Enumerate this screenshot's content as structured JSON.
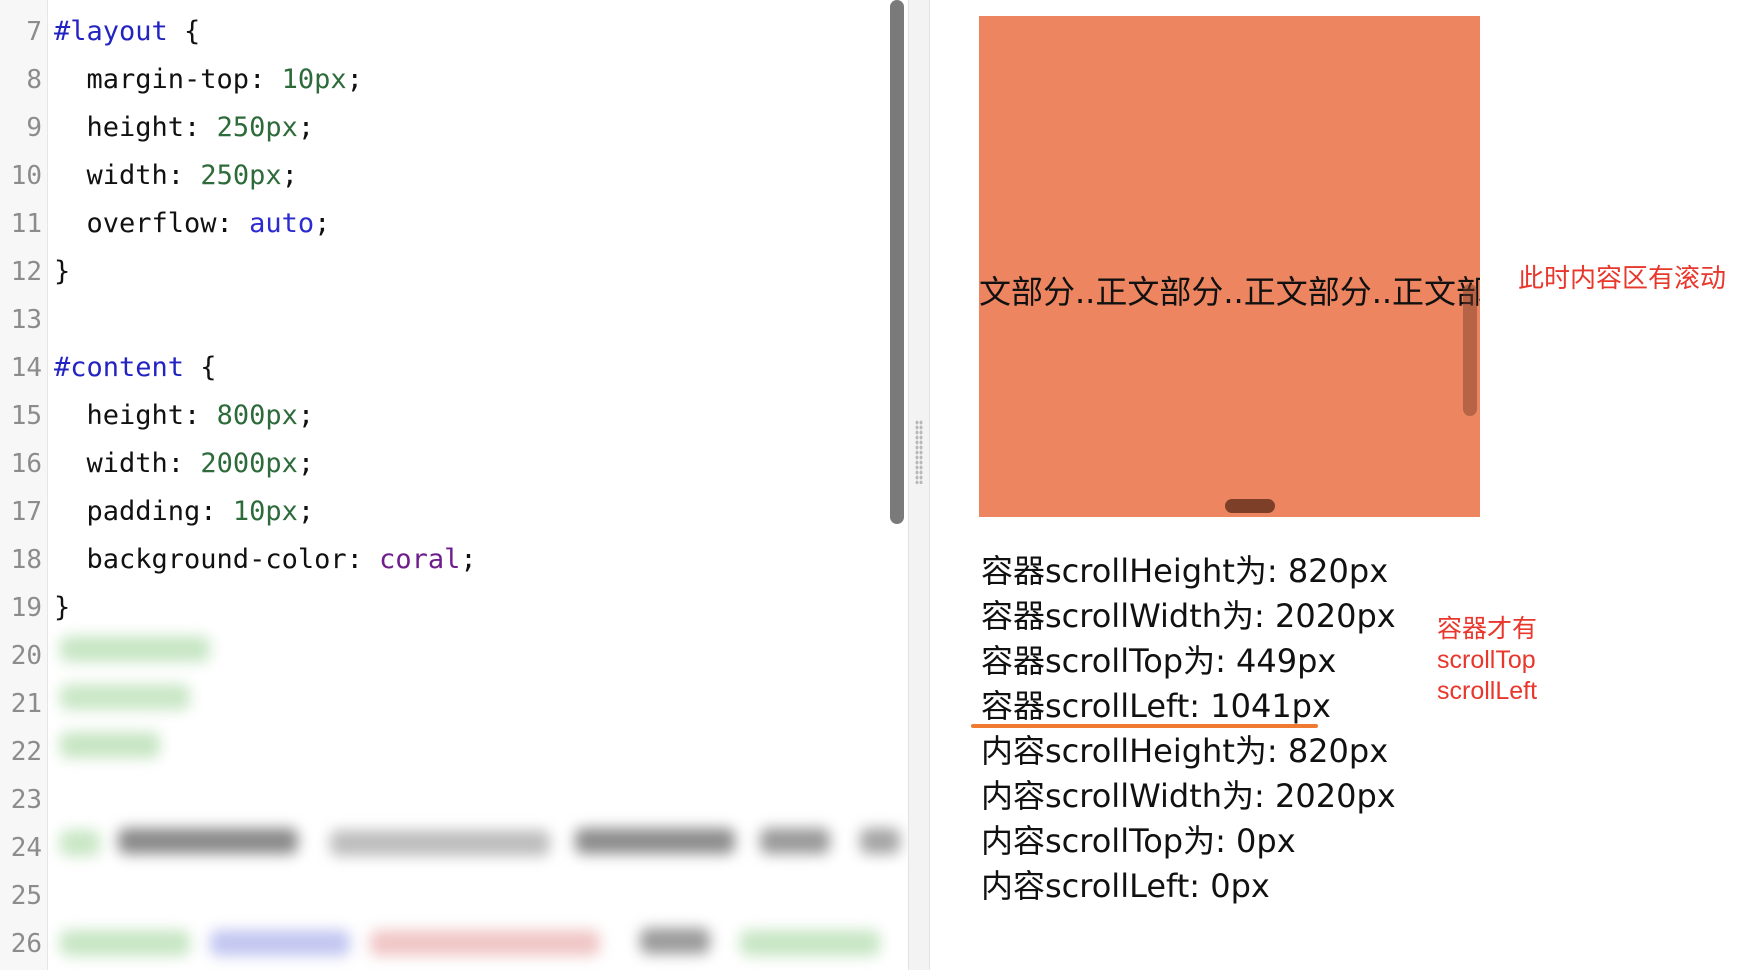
{
  "editor": {
    "lines": [
      {
        "num": "7",
        "tokens": [
          {
            "t": "#layout",
            "c": "sel"
          },
          {
            "t": " {",
            "c": ""
          }
        ]
      },
      {
        "num": "8",
        "tokens": [
          {
            "t": "  margin-top: ",
            "c": ""
          },
          {
            "t": "10px",
            "c": "num"
          },
          {
            "t": ";",
            "c": ""
          }
        ]
      },
      {
        "num": "9",
        "tokens": [
          {
            "t": "  height: ",
            "c": ""
          },
          {
            "t": "250px",
            "c": "num"
          },
          {
            "t": ";",
            "c": ""
          }
        ]
      },
      {
        "num": "10",
        "tokens": [
          {
            "t": "  width: ",
            "c": ""
          },
          {
            "t": "250px",
            "c": "num"
          },
          {
            "t": ";",
            "c": ""
          }
        ]
      },
      {
        "num": "11",
        "tokens": [
          {
            "t": "  overflow: ",
            "c": ""
          },
          {
            "t": "auto",
            "c": "kw"
          },
          {
            "t": ";",
            "c": ""
          }
        ]
      },
      {
        "num": "12",
        "tokens": [
          {
            "t": "}",
            "c": ""
          }
        ]
      },
      {
        "num": "13",
        "tokens": []
      },
      {
        "num": "14",
        "tokens": [
          {
            "t": "#content",
            "c": "sel"
          },
          {
            "t": " {",
            "c": ""
          }
        ]
      },
      {
        "num": "15",
        "tokens": [
          {
            "t": "  height: ",
            "c": ""
          },
          {
            "t": "800px",
            "c": "num"
          },
          {
            "t": ";",
            "c": ""
          }
        ]
      },
      {
        "num": "16",
        "tokens": [
          {
            "t": "  width: ",
            "c": ""
          },
          {
            "t": "2000px",
            "c": "num"
          },
          {
            "t": ";",
            "c": ""
          }
        ]
      },
      {
        "num": "17",
        "tokens": [
          {
            "t": "  padding: ",
            "c": ""
          },
          {
            "t": "10px",
            "c": "num"
          },
          {
            "t": ";",
            "c": ""
          }
        ]
      },
      {
        "num": "18",
        "tokens": [
          {
            "t": "  background-color: ",
            "c": ""
          },
          {
            "t": "coral",
            "c": "kw2"
          },
          {
            "t": ";",
            "c": ""
          }
        ]
      },
      {
        "num": "19",
        "tokens": [
          {
            "t": "}",
            "c": ""
          }
        ]
      },
      {
        "num": "20",
        "tokens": []
      },
      {
        "num": "21",
        "tokens": []
      },
      {
        "num": "22",
        "tokens": []
      },
      {
        "num": "23",
        "tokens": []
      },
      {
        "num": "24",
        "tokens": []
      },
      {
        "num": "25",
        "tokens": []
      },
      {
        "num": "26",
        "tokens": []
      }
    ]
  },
  "preview": {
    "content_text": "文部分..正文部分..正文部分..正文部分..正文部分..",
    "note_scroll": "此时内容区有滚动",
    "info": [
      "容器scrollHeight为: 820px",
      "容器scrollWidth为: 2020px",
      "容器scrollTop为: 449px",
      "容器scrollLeft: 1041px",
      "内容scrollHeight为: 820px",
      "内容scrollWidth为: 2020px",
      "内容scrollTop为: 0px",
      "内容scrollLeft: 0px"
    ],
    "note_side": [
      "容器才有",
      "scrollTop",
      "scrollLeft"
    ]
  },
  "colors": {
    "coral_box": "#ec8560",
    "annotation_red": "#e8372c",
    "underline_orange": "#f07a2f"
  }
}
